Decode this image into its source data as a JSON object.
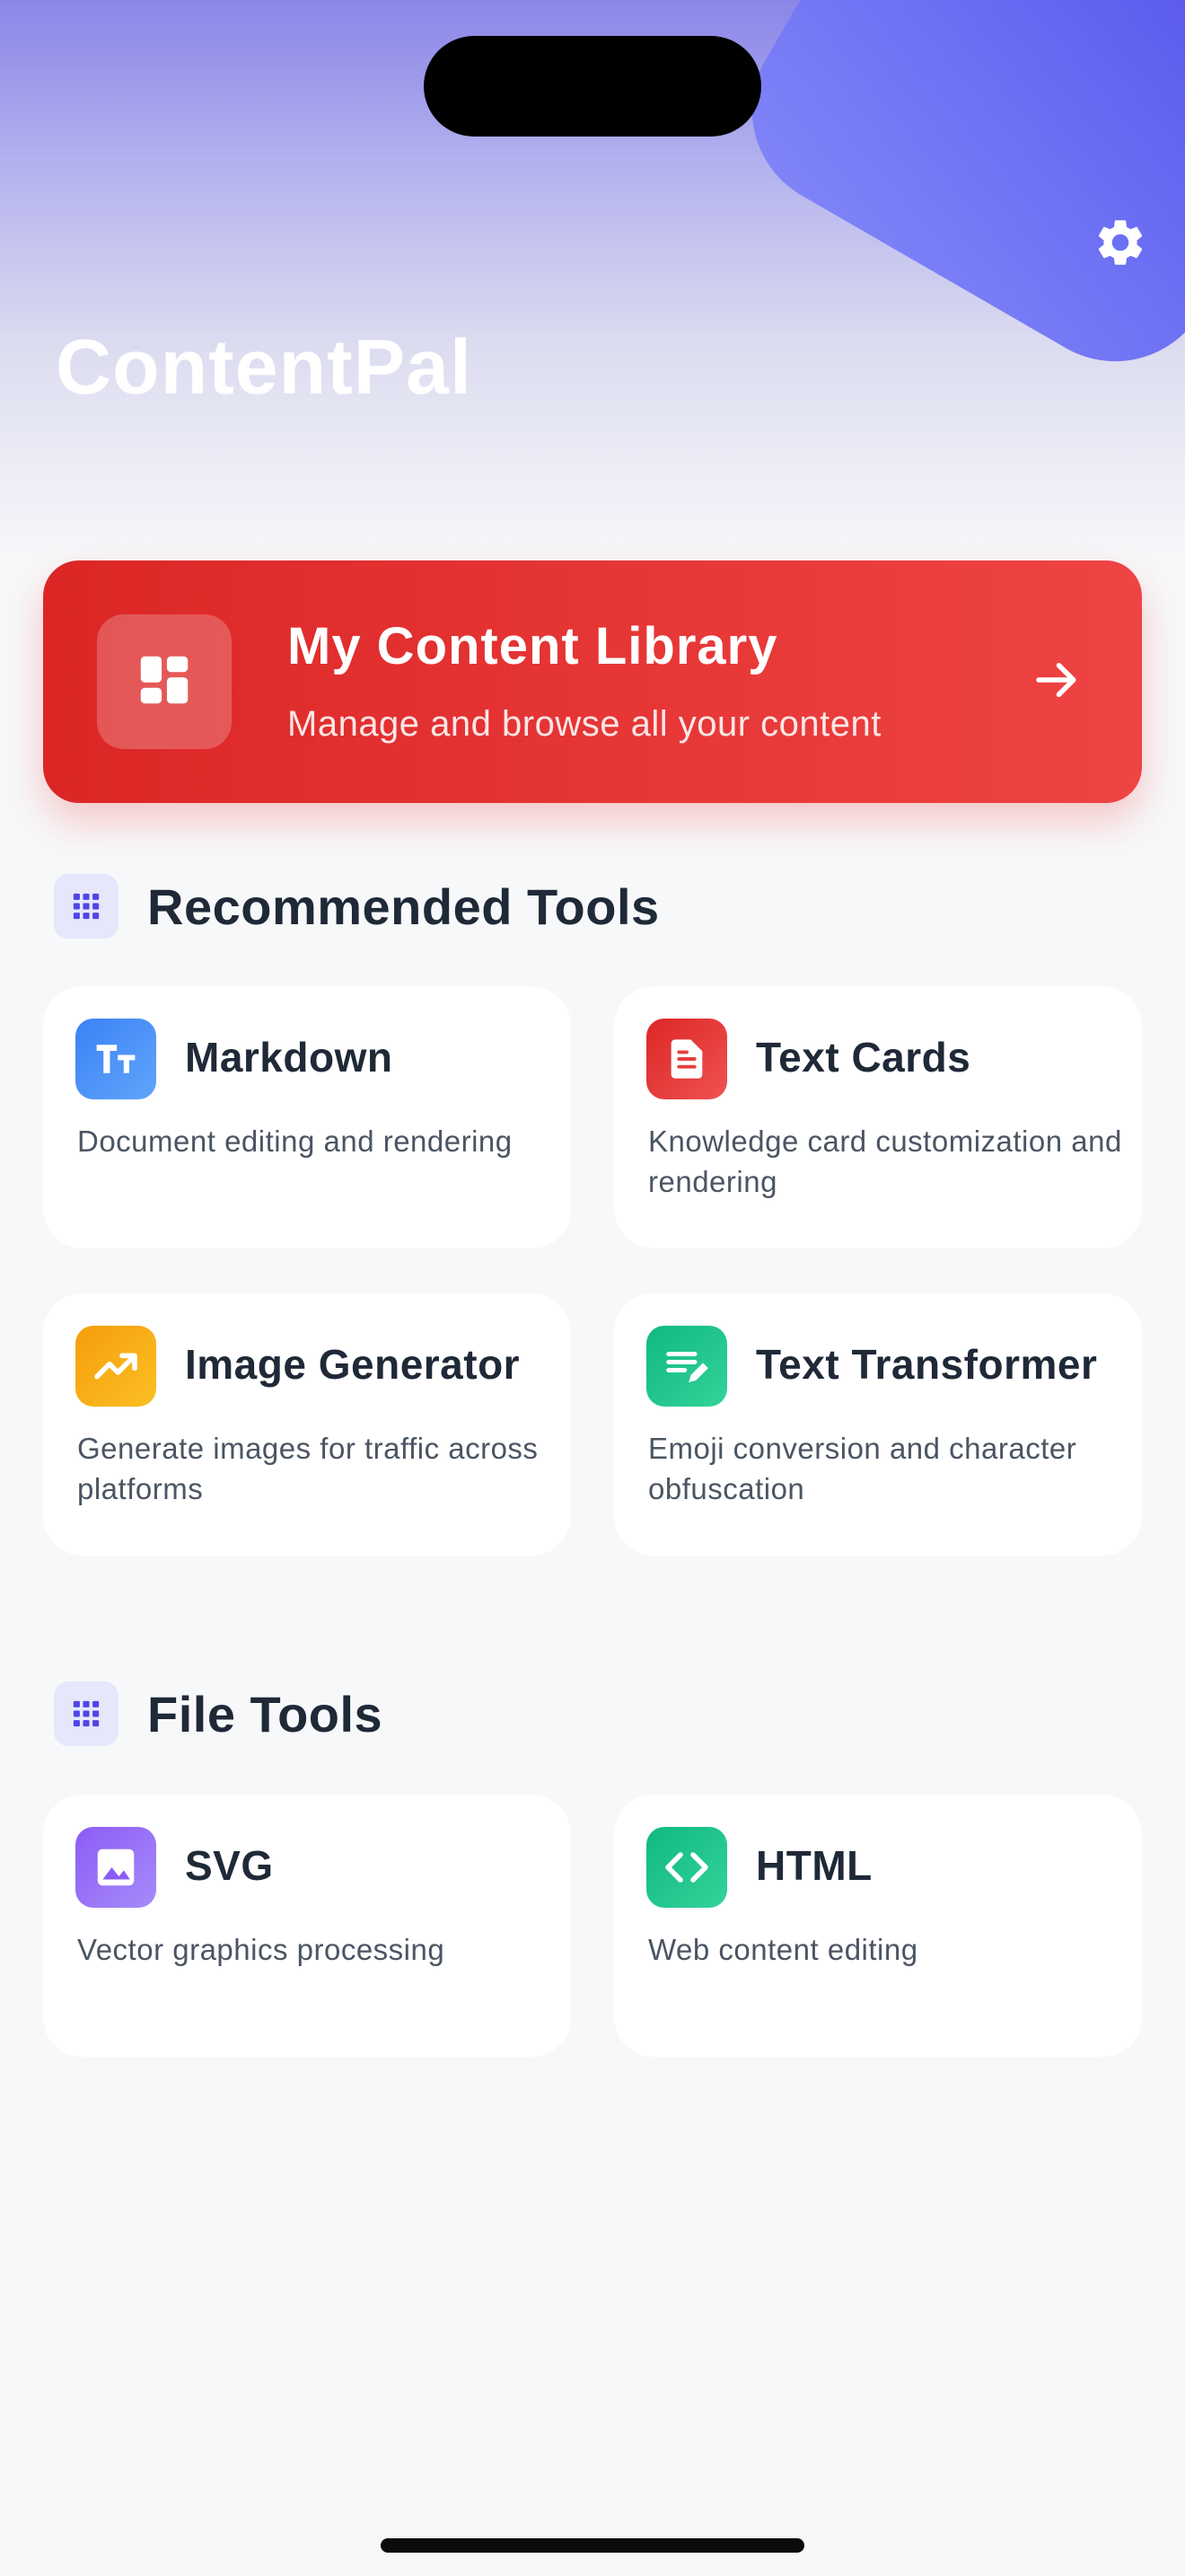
{
  "app": {
    "title": "ContentPal"
  },
  "header": {
    "settings_icon": "gear-icon"
  },
  "library": {
    "title": "My Content Library",
    "subtitle": "Manage and browse all your content",
    "icon": "dashboard-icon",
    "arrow_icon": "arrow-right-icon"
  },
  "sections": {
    "recommended": {
      "title": "Recommended Tools",
      "icon": "grid-icon"
    },
    "file": {
      "title": "File Tools",
      "icon": "grid-icon"
    }
  },
  "recommended_tools": [
    {
      "name": "Markdown",
      "description": "Document editing and rendering",
      "icon": "text-format-icon",
      "color": "#3b82f6"
    },
    {
      "name": "Text Cards",
      "description": "Knowledge card customization and rendering",
      "icon": "document-icon",
      "color": "#ef4444"
    },
    {
      "name": "Image Generator",
      "description": "Generate images for traffic across platforms",
      "icon": "trending-up-icon",
      "color": "#f59e0b"
    },
    {
      "name": "Text Transformer",
      "description": "Emoji conversion and character obfuscation",
      "icon": "edit-note-icon",
      "color": "#10b981"
    }
  ],
  "file_tools": [
    {
      "name": "SVG",
      "description": "Vector graphics processing",
      "icon": "image-icon",
      "color": "#8b5cf6"
    },
    {
      "name": "HTML",
      "description": "Web content editing",
      "icon": "code-icon",
      "color": "#10b981"
    }
  ],
  "colors": {
    "accent": "#6366f1",
    "library_card": "#ef4444",
    "background": "#f7f8fa"
  }
}
